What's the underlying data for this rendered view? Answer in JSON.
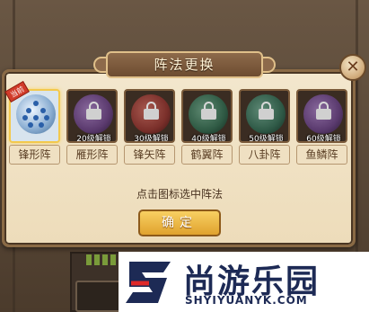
{
  "dialog": {
    "title": "阵法更换",
    "close_label": "✕",
    "hint": "点击图标选中阵法",
    "confirm_label": "确定"
  },
  "formations": [
    {
      "name": "锋形阵",
      "unlock": "",
      "tag": "当前",
      "active": true,
      "color": "#8fb1d4"
    },
    {
      "name": "雁形阵",
      "unlock": "20级解锁",
      "tag": "",
      "active": false,
      "color": "#5b3a6e"
    },
    {
      "name": "锋矢阵",
      "unlock": "30级解锁",
      "tag": "",
      "active": false,
      "color": "#7a2f2a"
    },
    {
      "name": "鹤翼阵",
      "unlock": "40级解锁",
      "tag": "",
      "active": false,
      "color": "#2f5a44"
    },
    {
      "name": "八卦阵",
      "unlock": "50级解锁",
      "tag": "",
      "active": false,
      "color": "#2f5a47"
    },
    {
      "name": "鱼鳞阵",
      "unlock": "60级解锁",
      "tag": "",
      "active": false,
      "color": "#5a3a6e"
    }
  ],
  "watermark": {
    "brand": "尚游乐园",
    "url": "SHYIYUANYK.COM"
  },
  "colors": {
    "dialog_bg": "#f3e7cd",
    "banner": "#8d6a4b",
    "confirm": "#f8d062",
    "active_border": "#f3c94d"
  }
}
